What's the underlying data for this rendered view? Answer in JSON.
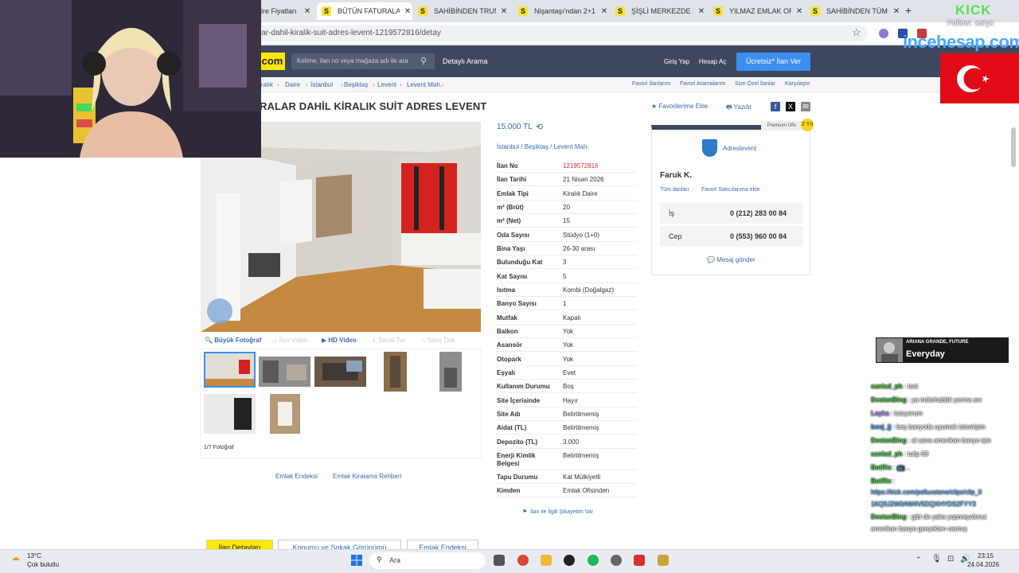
{
  "browser": {
    "tabs": [
      {
        "label": "ire Fiyatları",
        "fav": ""
      },
      {
        "label": "BÜTÜN FATURALAR D",
        "fav": "S"
      },
      {
        "label": "SAHİBİNDEN TRUMP",
        "fav": "S"
      },
      {
        "label": "Nişantaşı'ndan 2+1 v",
        "fav": "S"
      },
      {
        "label": "ŞİŞLİ MERKEZDE 3+1",
        "fav": "S"
      },
      {
        "label": "YILMAZ EMLAK ORTA",
        "fav": "S"
      },
      {
        "label": "SAHİBİNDEN TÜM FA",
        "fav": "S"
      }
    ],
    "new_tab": "+",
    "close_glyph": "✕",
    "url": "lar-dahil-kiralik-suit-adres-levent-1219572816/detay"
  },
  "site": {
    "logo": "com",
    "search_placeholder": "Kelime, ilan no veya mağaza adı ile ara",
    "detailed_search": "Detaylı Arama",
    "login": "Giriş Yap",
    "register": "Hesap Aç",
    "post_ad": "Ücretsiz* İlan Ver"
  },
  "breadcrumb": [
    "iralık",
    "Daire",
    "İstanbul",
    "Beşiktaş",
    "Levent",
    "Levent Mah."
  ],
  "breadcrumb_right": [
    "Favori İlanlarım",
    "Favori Aramalarım",
    "Size Özel İlanlar",
    "Karşılaştır"
  ],
  "listing": {
    "title": "RALAR DAHİL KİRALIK SUİT ADRES LEVENT",
    "add_favorite": "Favorilerime Ekle",
    "print": "Yazdır",
    "price": "15.000 TL",
    "location": [
      "İstanbul",
      "Beşiktaş",
      "Levent Mah."
    ],
    "details": [
      {
        "label": "İlan No",
        "value": "1219572816"
      },
      {
        "label": "İlan Tarihi",
        "value": "21 Nisan 2026"
      },
      {
        "label": "Emlak Tipi",
        "value": "Kiralık Daire"
      },
      {
        "label": "m² (Brüt)",
        "value": "20"
      },
      {
        "label": "m² (Net)",
        "value": "15"
      },
      {
        "label": "Oda Sayısı",
        "value": "Stüdyo (1+0)"
      },
      {
        "label": "Bina Yaşı",
        "value": "26-30 arası"
      },
      {
        "label": "Bulunduğu Kat",
        "value": "3"
      },
      {
        "label": "Kat Sayısı",
        "value": "5"
      },
      {
        "label": "Isıtma",
        "value": "Kombi (Doğalgaz)"
      },
      {
        "label": "Banyo Sayısı",
        "value": "1"
      },
      {
        "label": "Mutfak",
        "value": "Kapalı"
      },
      {
        "label": "Balkon",
        "value": "Yok"
      },
      {
        "label": "Asansör",
        "value": "Yok"
      },
      {
        "label": "Otopark",
        "value": "Yok"
      },
      {
        "label": "Eşyalı",
        "value": "Evet"
      },
      {
        "label": "Kullanım Durumu",
        "value": "Boş"
      },
      {
        "label": "Site İçerisinde",
        "value": "Hayır"
      },
      {
        "label": "Site Adı",
        "value": "Belirtilmemiş"
      },
      {
        "label": "Aidat (TL)",
        "value": "Belirtilmemiş"
      },
      {
        "label": "Depozito (TL)",
        "value": "3.000"
      },
      {
        "label": "Enerji Kimlik Belgesi",
        "value": "Belirtilmemiş"
      },
      {
        "label": "Tapu Durumu",
        "value": "Kat Mülkiyetli"
      },
      {
        "label": "Kimden",
        "value": "Emlak Ofisinden"
      }
    ],
    "complaint": "İlan ile İlgili Şikayetim Var",
    "photo_tools": {
      "big_photo": "Büyük Fotoğraf",
      "ad_video": "İlan Video",
      "hd_video": "HD Video",
      "virtual_tour": "Sanal Tur",
      "sale_doc": "Satış Dok"
    },
    "photo_count": "1/7 Fotoğraf",
    "index_link": "Emlak Endeksi",
    "guide_link": "Emlak Kiralama Rehberi",
    "bottom_tabs": [
      "İlan Detayları",
      "Konumu ve Sokak Görünümü",
      "Emlak Endeksi"
    ]
  },
  "seller": {
    "premium": "Premium Ofis",
    "premium_badge": "2 Yıl",
    "store_name": "Adreslevent",
    "name": "Faruk K.",
    "all_listings": "Tüm ilanları",
    "add_fav": "Favori Satıcılarıma ekle",
    "phones": [
      {
        "label": "İş",
        "number": "0 (212) 283 00 84"
      },
      {
        "label": "Cep",
        "number": "0 (553) 960 00 84"
      }
    ],
    "message": "Mesaj gönder"
  },
  "stream": {
    "kick_text": "KICK",
    "follow_text": "Follow: xoryx",
    "sponsor": "incehesap.com",
    "music_artist": "ARIANA GRANDE, FUTURE",
    "music_title": "Everyday",
    "chat": [
      {
        "user": "sanlad_ph",
        "msg": "test",
        "color": "#4ed34e"
      },
      {
        "user": "DestanBing",
        "msg": "ya mütehabbit yarrna aw",
        "color": "#4ed34e"
      },
      {
        "user": "Leyka",
        "msg": "tutuyorum",
        "color": "#b48cf0"
      },
      {
        "user": "benj_jj",
        "msg": "beş banyoda uyumak istemişim",
        "color": "#4aa8ff"
      },
      {
        "user": "DestanBing",
        "msg": "al sana amerikan banyo işte",
        "color": "#4ed34e"
      },
      {
        "user": "sanlad_ph",
        "msg": "tulip 63",
        "color": "#4ed34e"
      },
      {
        "user": "BotRix",
        "msg": "📺...",
        "color": "#4ed34e"
      },
      {
        "user": "BotRix",
        "msg": "",
        "color": "#4ed34e"
      },
      {
        "user": "",
        "msg": "https://kick.com/polluxstone/clips/clip_0",
        "color": "#4aa8ff"
      },
      {
        "user": "",
        "msg": "1KQ0J2W0AW4V5DQXHYDS2FYY3",
        "color": "#4aa8ff"
      },
      {
        "user": "DestanBing",
        "msg": "gibi de yaka yapmayaltınız",
        "color": "#4ed34e"
      },
      {
        "user": "",
        "msg": "amerikan banyo gerçekten varmış",
        "color": "#fff"
      }
    ]
  },
  "taskbar": {
    "temp": "13°C",
    "condition": "Çok bulutlu",
    "search": "Ara",
    "time": "23:15",
    "date": "24.04.2026"
  }
}
